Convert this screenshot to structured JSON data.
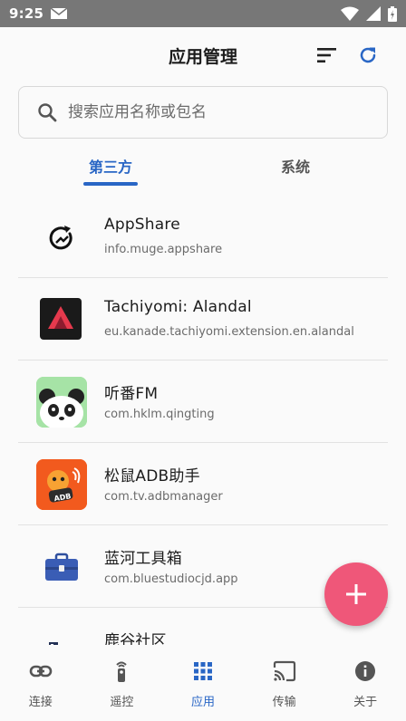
{
  "status_bar": {
    "time": "9:25"
  },
  "header": {
    "title": "应用管理"
  },
  "search": {
    "placeholder": "搜索应用名称或包名"
  },
  "tabs": [
    {
      "label": "第三方",
      "active": true
    },
    {
      "label": "系统",
      "active": false
    }
  ],
  "apps": [
    {
      "name": "AppShare",
      "package": "info.muge.appshare"
    },
    {
      "name": "Tachiyomi: Alandal",
      "package": "eu.kanade.tachiyomi.extension.en.alandal"
    },
    {
      "name": "听番FM",
      "package": "com.hklm.qingting"
    },
    {
      "name": "松鼠ADB助手",
      "package": "com.tv.adbmanager"
    },
    {
      "name": "蓝河工具箱",
      "package": "com.bluestudiocjd.app"
    },
    {
      "name": "鹿谷社区",
      "package": ""
    }
  ],
  "icon_badges": {
    "adb": "ADB"
  },
  "bottom_nav": [
    {
      "label": "连接",
      "icon": "link-icon",
      "active": false
    },
    {
      "label": "遥控",
      "icon": "remote-icon",
      "active": false
    },
    {
      "label": "应用",
      "icon": "apps-grid-icon",
      "active": true
    },
    {
      "label": "传输",
      "icon": "cast-icon",
      "active": false
    },
    {
      "label": "关于",
      "icon": "info-icon",
      "active": false
    }
  ],
  "colors": {
    "accent": "#2966c5",
    "fab": "#ef5779",
    "status_bar": "#777777"
  }
}
